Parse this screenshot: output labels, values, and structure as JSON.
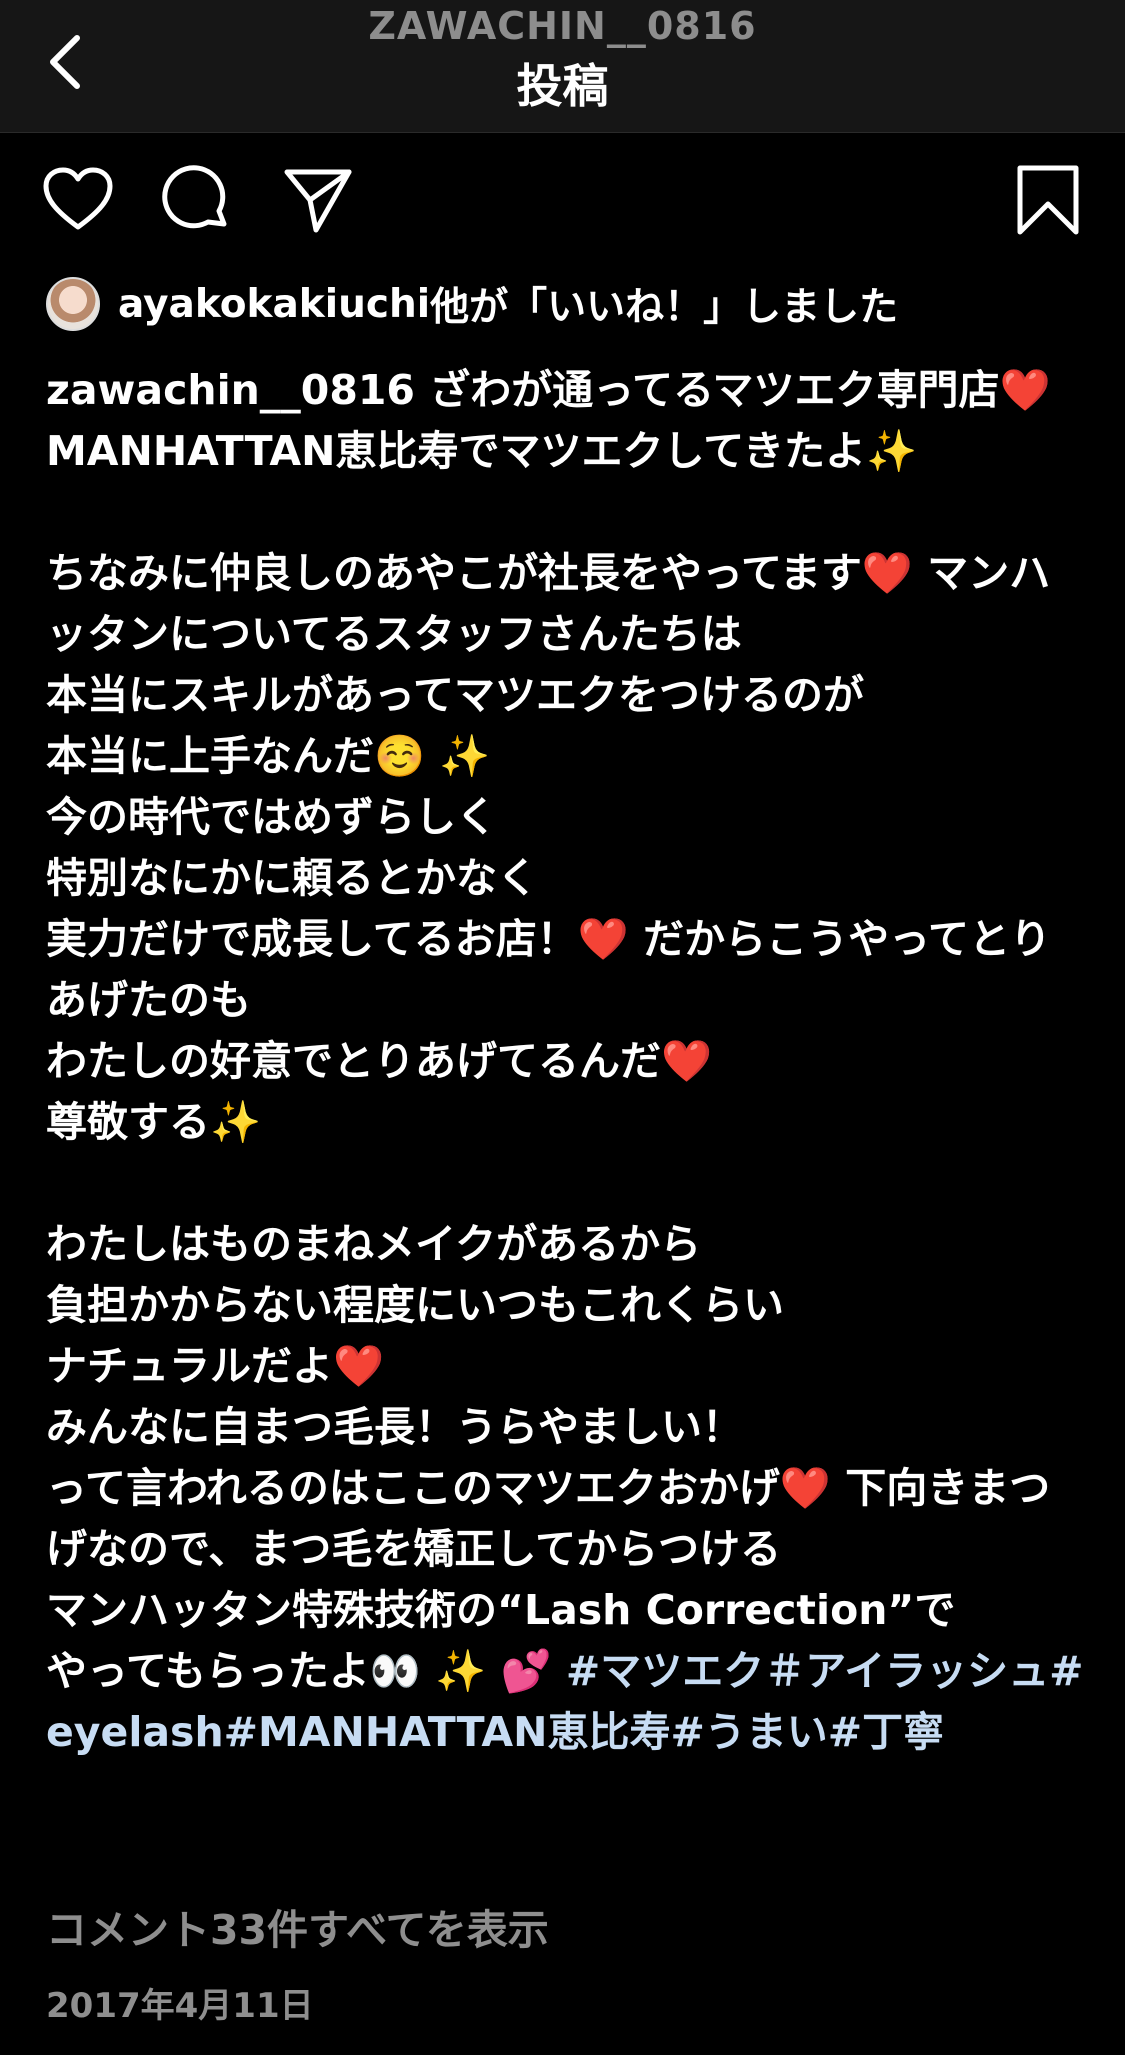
{
  "header": {
    "username": "ZAWACHIN__0816",
    "title": "投稿"
  },
  "icons": {
    "back": "chevron-left-icon",
    "like": "heart-icon",
    "comment": "comment-icon",
    "share": "send-icon",
    "save": "bookmark-icon"
  },
  "likes": {
    "user": "ayakokakiuchi",
    "suffix": "他が「いいね！」しました"
  },
  "caption": {
    "username": "zawachin__0816",
    "text": " ざわが通ってるマツエク専門店❤️\nMANHATTAN恵比寿でマツエクしてきたよ✨\n\nちなみに仲良しのあやこが社長をやってます❤️ マンハッタンについてるスタッフさんたちは\n本当にスキルがあってマツエクをつけるのが\n本当に上手なんだ☺️ ✨\n今の時代ではめずらしく\n特別なにかに頼るとかなく\n実力だけで成長してるお店！❤️ だからこうやってとりあげたのも\nわたしの好意でとりあげてるんだ❤️\n尊敬する✨\n\nわたしはものまねメイクがあるから\n負担かからない程度にいつもこれくらい\nナチュラルだよ❤️\nみんなに自まつ毛長！うらやましい！\nって言われるのはここのマツエクおかげ❤️ 下向きまつげなので、まつ毛を矯正してからつける\nマンハッタン特殊技術の“Lash Correction”で\nやってもらったよ👀 ✨ 💕 ",
    "hashtags": "#マツエク＃アイラッシュ#eyelash#MANHATTAN恵比寿#うまい#丁寧"
  },
  "comments_link": "コメント33件すべてを表示",
  "date": "2017年4月11日"
}
